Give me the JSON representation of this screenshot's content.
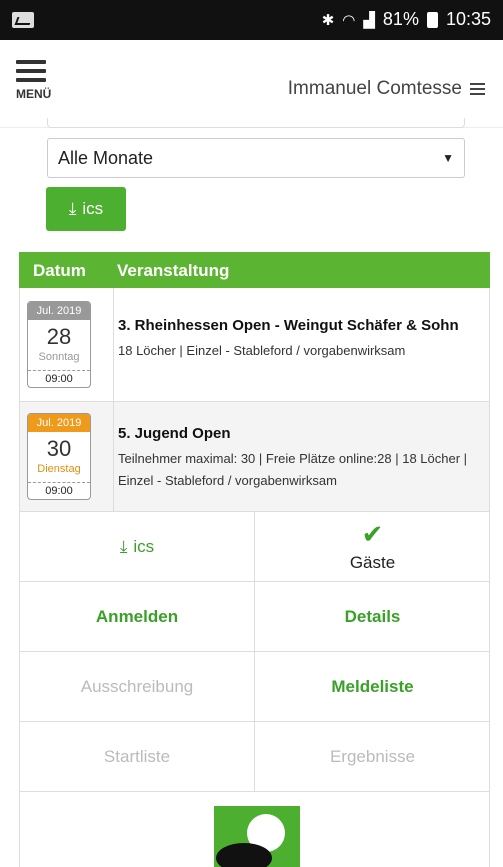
{
  "status_bar": {
    "icons": [
      "activity-icon",
      "bluetooth-icon",
      "wifi-icon",
      "signal-icon"
    ],
    "battery": "81%",
    "time": "10:35"
  },
  "header": {
    "menu_label": "MENÜ",
    "user_name": "Immanuel Comtesse"
  },
  "filter": {
    "month_value": "Alle Monate",
    "ics_label": "ics"
  },
  "table": {
    "col_date": "Datum",
    "col_event": "Veranstaltung",
    "events": [
      {
        "month": "Jul. 2019",
        "day": "28",
        "weekday": "Sonntag",
        "time": "09:00",
        "title": "3. Rheinhessen Open - Weingut Schäfer & Sohn",
        "meta": "18 Löcher | Einzel - Stableford / vorgabenwirksam"
      },
      {
        "month": "Jul. 2019",
        "day": "30",
        "weekday": "Dienstag",
        "time": "09:00",
        "title": "5. Jugend Open",
        "meta": "Teilnehmer maximal: 30 | Freie Plätze online:28 | 18 Löcher | Einzel - Stableford / vorgabenwirksam"
      }
    ]
  },
  "actions": {
    "ics": "ics",
    "gaeste": "Gäste",
    "anmelden": "Anmelden",
    "details": "Details",
    "ausschreibung": "Ausschreibung",
    "meldeliste": "Meldeliste",
    "startliste": "Startliste",
    "ergebnisse": "Ergebnisse"
  },
  "colors": {
    "accent_green": "#5cb532",
    "button_green": "#4caf2f",
    "highlight_orange": "#ef9a1a"
  }
}
